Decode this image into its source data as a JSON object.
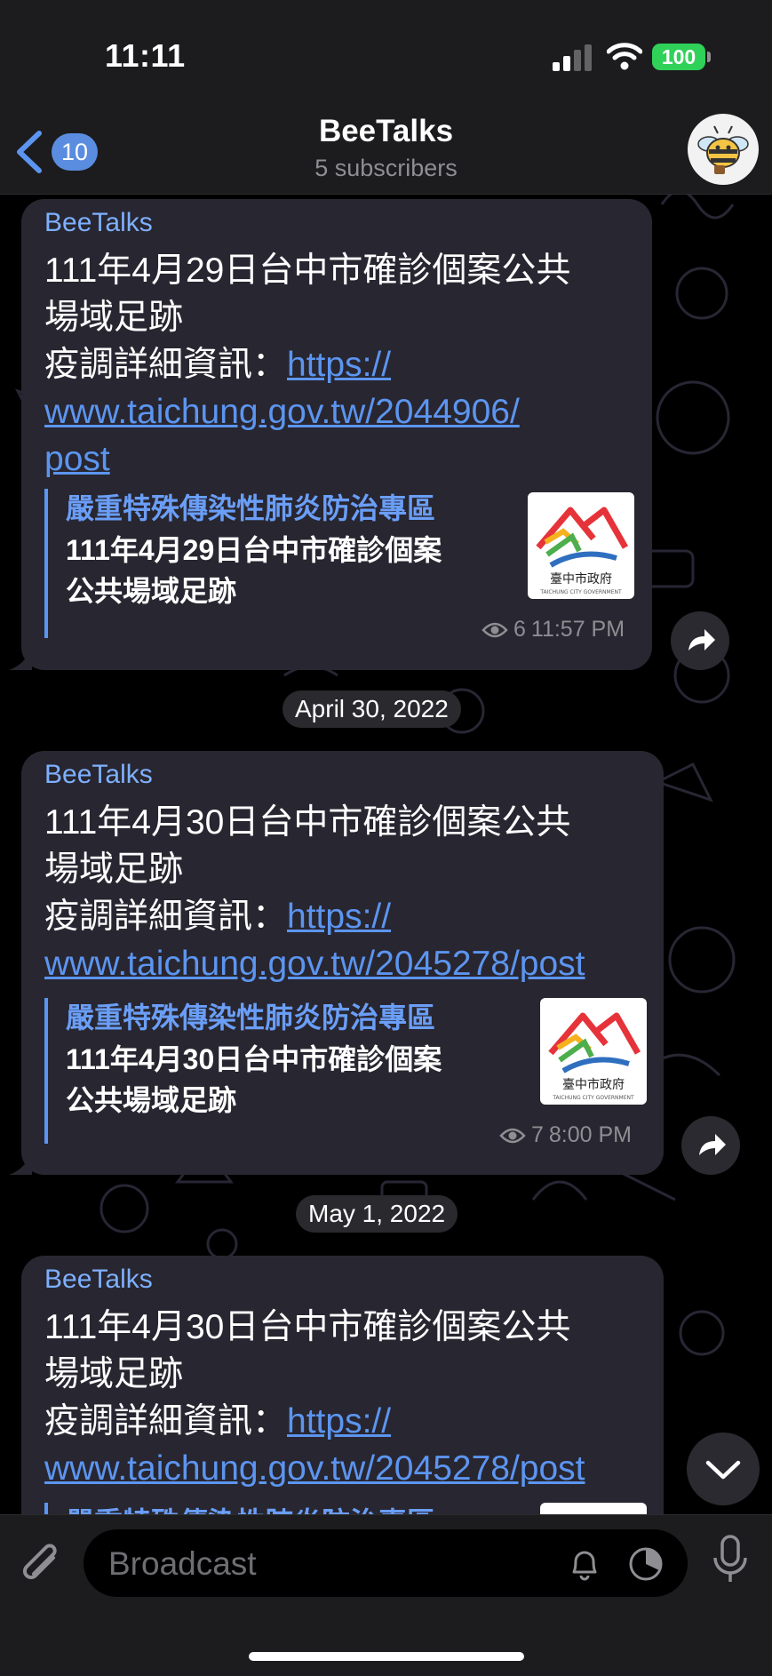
{
  "status_bar": {
    "time": "11:11",
    "battery": "100"
  },
  "header": {
    "back_count": "10",
    "title": "BeeTalks",
    "subtitle": "5 subscribers"
  },
  "messages": [
    {
      "sender": "BeeTalks",
      "title_line1": "111年4月29日台中市確診個案公共",
      "title_line2": "場域足跡",
      "info_label": "疫調詳細資訊：",
      "link_part1": "https://",
      "link_part2": "www.taichung.gov.tw/2044906/",
      "link_part3": "post",
      "preview_site": "嚴重特殊傳染性肺炎防治專區",
      "preview_title_line1": "111年4月29日台中市確診個案",
      "preview_title_line2": "公共場域足跡",
      "views": "6",
      "time": "11:57 PM"
    },
    {
      "sender": "BeeTalks",
      "title_line1": "111年4月30日台中市確診個案公共",
      "title_line2": "場域足跡",
      "info_label": "疫調詳細資訊：",
      "link_part1": "https://",
      "link_part2": "www.taichung.gov.tw/2045278/post",
      "preview_site": "嚴重特殊傳染性肺炎防治專區",
      "preview_title_line1": "111年4月30日台中市確診個案",
      "preview_title_line2": "公共場域足跡",
      "views": "7",
      "time": "8:00 PM"
    },
    {
      "sender": "BeeTalks",
      "title_line1": "111年4月30日台中市確診個案公共",
      "title_line2": "場域足跡",
      "info_label": "疫調詳細資訊：",
      "link_part1": "https://",
      "link_part2": "www.taichung.gov.tw/2045278/post",
      "preview_site": "嚴重特殊傳染性肺炎防治專區"
    }
  ],
  "date_separators": [
    "April 30, 2022",
    "May 1, 2022"
  ],
  "thumbnail": {
    "logo_text": "臺中市政府",
    "logo_subtext": "TAICHUNG CITY GOVERNMENT"
  },
  "input": {
    "placeholder": "Broadcast"
  },
  "colors": {
    "accent": "#5c95f0",
    "bubble": "#282630",
    "battery": "#30d158"
  }
}
